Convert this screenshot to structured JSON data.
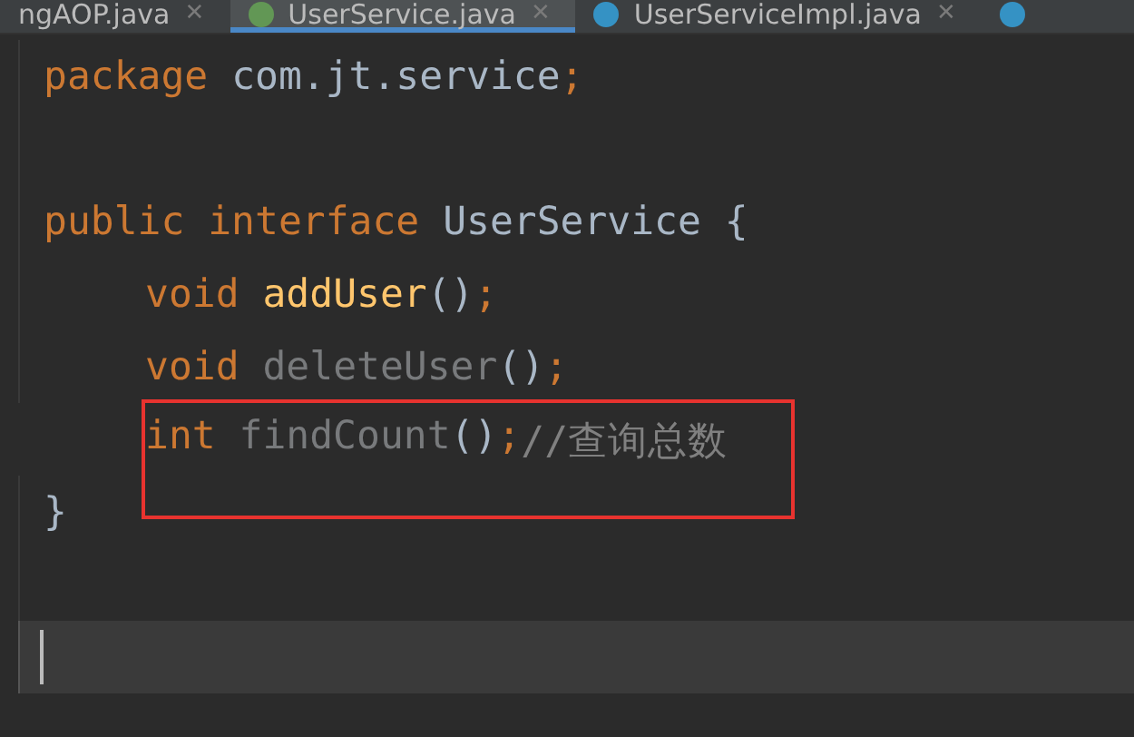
{
  "tabs": [
    {
      "label": "ngAOP.java",
      "close": "✕",
      "selected": false
    },
    {
      "label": "UserService.java",
      "close": "✕",
      "kind": "interface",
      "selected": true
    },
    {
      "label": "UserServiceImpl.java",
      "close": "✕",
      "kind": "class",
      "selected": false
    },
    {
      "kind": "class",
      "selected": false
    }
  ],
  "editor": {
    "lines": [
      {
        "boxed": false,
        "current": false,
        "indent": false,
        "tokens": [
          {
            "kind": "keyword",
            "text": "package "
          },
          {
            "kind": "plain",
            "text": "com.jt.service"
          },
          {
            "kind": "keyword",
            "text": ";"
          }
        ]
      },
      {
        "boxed": false,
        "current": false
      },
      {
        "boxed": false,
        "current": false,
        "indent": false,
        "tokens": [
          {
            "kind": "keyword",
            "text": "public interface "
          },
          {
            "kind": "plain",
            "text": "UserService {"
          }
        ]
      },
      {
        "boxed": false,
        "current": false,
        "indent": true,
        "tokens": [
          {
            "kind": "keyword",
            "text": "void "
          },
          {
            "kind": "method",
            "text": "addUser"
          },
          {
            "kind": "plain",
            "text": "()"
          },
          {
            "kind": "keyword",
            "text": ";"
          }
        ]
      },
      {
        "boxed": false,
        "current": false,
        "indent": true,
        "tokens": [
          {
            "kind": "keyword",
            "text": "void "
          },
          {
            "kind": "unused",
            "text": "deleteUser"
          },
          {
            "kind": "plain",
            "text": "()"
          },
          {
            "kind": "keyword",
            "text": ";"
          }
        ]
      },
      {
        "boxed": true,
        "current": false,
        "indent": true,
        "tokens": [
          {
            "kind": "keyword",
            "text": "int "
          },
          {
            "kind": "unused",
            "text": "findCount"
          },
          {
            "kind": "plain",
            "text": "()"
          },
          {
            "kind": "keyword",
            "text": ";"
          },
          {
            "kind": "comment",
            "text": "//查询总数"
          }
        ]
      },
      {
        "boxed": false,
        "current": false,
        "indent": false,
        "tokens": [
          {
            "kind": "plain",
            "text": "}"
          }
        ]
      },
      {
        "boxed": false,
        "current": false
      },
      {
        "boxed": false,
        "current": true
      }
    ]
  }
}
